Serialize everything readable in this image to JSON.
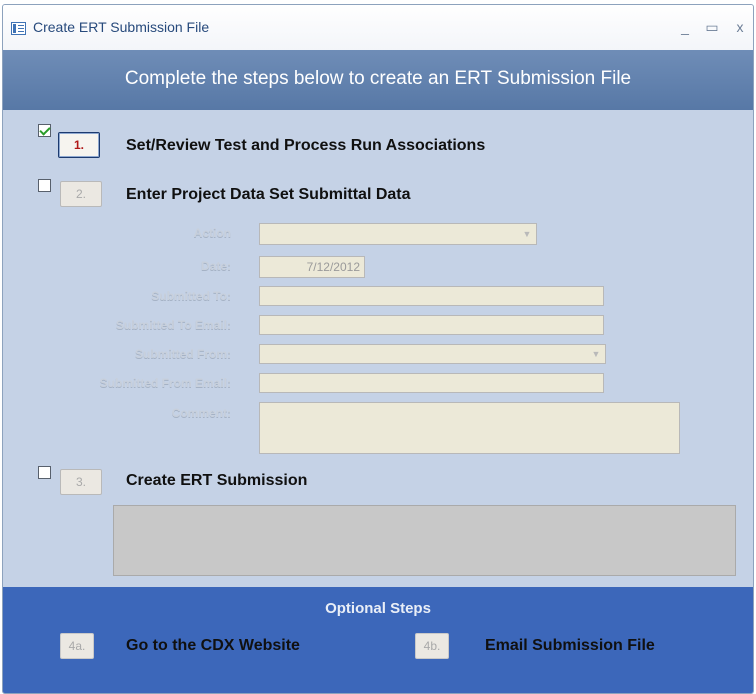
{
  "window": {
    "title": "Create ERT Submission File",
    "controls": {
      "minimize": "_",
      "maximize": "▭",
      "close": "x"
    }
  },
  "header": {
    "text": "Complete the steps below to create an ERT Submission File"
  },
  "steps": [
    {
      "number": "1.",
      "label": "Set/Review Test and Process Run Associations",
      "checked": true,
      "enabled": true
    },
    {
      "number": "2.",
      "label": "Enter Project Data Set Submittal Data",
      "checked": false,
      "enabled": false
    },
    {
      "number": "3.",
      "label": "Create ERT Submission",
      "checked": false,
      "enabled": false
    }
  ],
  "form": {
    "action": {
      "label": "Action",
      "value": ""
    },
    "date": {
      "label": "Date:",
      "value": "7/12/2012"
    },
    "submitted_to": {
      "label": "Submitted To:",
      "value": ""
    },
    "submitted_to_email": {
      "label": "Submitted To Email:",
      "value": ""
    },
    "submitted_from": {
      "label": "Submitted From:",
      "value": ""
    },
    "submitted_from_email": {
      "label": "Submitted From Email:",
      "value": ""
    },
    "comment": {
      "label": "Comment:",
      "value": ""
    }
  },
  "optional": {
    "title": "Optional Steps",
    "steps": [
      {
        "number": "4a.",
        "label": "Go to the CDX Website"
      },
      {
        "number": "4b.",
        "label": "Email Submission File"
      }
    ]
  },
  "colors": {
    "header_bar": "#6381af",
    "body": "#c5d2e6",
    "optional_bar": "#3c67ba",
    "active_step_number": "#b01818"
  }
}
